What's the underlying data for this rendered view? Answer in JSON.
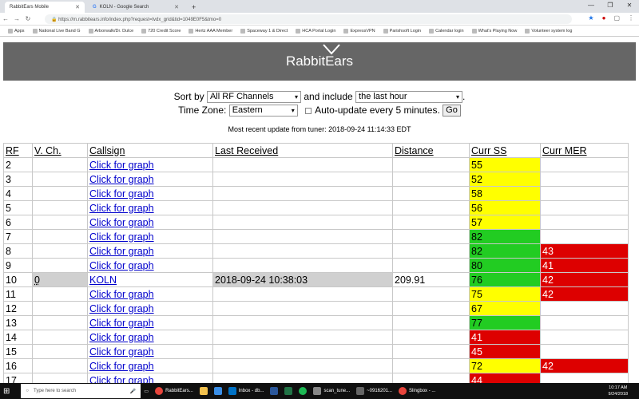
{
  "browser": {
    "tabs": [
      {
        "label": "RabbitEars Mobile",
        "active": true
      },
      {
        "label": "KOLN - Google Search",
        "active": false
      }
    ],
    "new_tab": "+",
    "url": "https://m.rabbitears.info/index.php?request=tvdx_grid&tid=1049E0F5&tmo=0",
    "bookmarks": [
      "Apps",
      "National Live Band G",
      "Arborwalk/Dr. Dulce",
      "720 Credit Score",
      "Hertz AAA Member",
      "Spaceway 1 & Direct",
      "HCA Portal Login",
      "ExpressVPN",
      "Parishsoft Login",
      "Calendar login",
      "What's Playing Now",
      "Volunteer system log"
    ]
  },
  "page": {
    "logo": "RabbitEars",
    "sort_label": "Sort by",
    "sort_value": "All RF Channels",
    "include_label": "and include",
    "include_value": "the last hour",
    "timezone_label": "Time Zone:",
    "timezone_value": "Eastern",
    "auto_label": "Auto-update every 5 minutes.",
    "go_label": "Go",
    "update_text": "Most recent update from tuner: 2018-09-24 11:14:33 EDT"
  },
  "table": {
    "headers": [
      "RF",
      "V. Ch.",
      "Callsign",
      "Last Received",
      "Distance",
      "Curr SS",
      "Curr MER"
    ],
    "rows": [
      {
        "rf": "2",
        "vch": "",
        "callsign": "Click for graph",
        "last": "",
        "dist": "",
        "ss": "55",
        "ss_c": "y",
        "mer": "",
        "mer_c": ""
      },
      {
        "rf": "3",
        "vch": "",
        "callsign": "Click for graph",
        "last": "",
        "dist": "",
        "ss": "52",
        "ss_c": "y",
        "mer": "",
        "mer_c": ""
      },
      {
        "rf": "4",
        "vch": "",
        "callsign": "Click for graph",
        "last": "",
        "dist": "",
        "ss": "58",
        "ss_c": "y",
        "mer": "",
        "mer_c": ""
      },
      {
        "rf": "5",
        "vch": "",
        "callsign": "Click for graph",
        "last": "",
        "dist": "",
        "ss": "56",
        "ss_c": "y",
        "mer": "",
        "mer_c": ""
      },
      {
        "rf": "6",
        "vch": "",
        "callsign": "Click for graph",
        "last": "",
        "dist": "",
        "ss": "57",
        "ss_c": "y",
        "mer": "",
        "mer_c": ""
      },
      {
        "rf": "7",
        "vch": "",
        "callsign": "Click for graph",
        "last": "",
        "dist": "",
        "ss": "82",
        "ss_c": "g",
        "mer": "",
        "mer_c": ""
      },
      {
        "rf": "8",
        "vch": "",
        "callsign": "Click for graph",
        "last": "",
        "dist": "",
        "ss": "82",
        "ss_c": "g",
        "mer": "43",
        "mer_c": "r"
      },
      {
        "rf": "9",
        "vch": "",
        "callsign": "Click for graph",
        "last": "",
        "dist": "",
        "ss": "80",
        "ss_c": "g",
        "mer": "41",
        "mer_c": "r"
      },
      {
        "rf": "10",
        "vch": "0",
        "callsign": "KOLN",
        "last": "2018-09-24 10:38:03",
        "dist": "209.91",
        "ss": "76",
        "ss_c": "g",
        "mer": "42",
        "mer_c": "r",
        "grey": true
      },
      {
        "rf": "11",
        "vch": "",
        "callsign": "Click for graph",
        "last": "",
        "dist": "",
        "ss": "75",
        "ss_c": "y",
        "mer": "42",
        "mer_c": "r"
      },
      {
        "rf": "12",
        "vch": "",
        "callsign": "Click for graph",
        "last": "",
        "dist": "",
        "ss": "67",
        "ss_c": "y",
        "mer": "",
        "mer_c": ""
      },
      {
        "rf": "13",
        "vch": "",
        "callsign": "Click for graph",
        "last": "",
        "dist": "",
        "ss": "77",
        "ss_c": "g",
        "mer": "",
        "mer_c": ""
      },
      {
        "rf": "14",
        "vch": "",
        "callsign": "Click for graph",
        "last": "",
        "dist": "",
        "ss": "41",
        "ss_c": "r",
        "mer": "",
        "mer_c": ""
      },
      {
        "rf": "15",
        "vch": "",
        "callsign": "Click for graph",
        "last": "",
        "dist": "",
        "ss": "45",
        "ss_c": "r",
        "mer": "",
        "mer_c": ""
      },
      {
        "rf": "16",
        "vch": "",
        "callsign": "Click for graph",
        "last": "",
        "dist": "",
        "ss": "72",
        "ss_c": "y",
        "mer": "42",
        "mer_c": "r"
      },
      {
        "rf": "17",
        "vch": "",
        "callsign": "Click for graph",
        "last": "",
        "dist": "",
        "ss": "44",
        "ss_c": "r",
        "mer": "",
        "mer_c": ""
      }
    ]
  },
  "taskbar": {
    "search_placeholder": "Type here to search",
    "items": [
      "RabbitEars...",
      "Inbox - db...",
      "scan_tune...",
      "~0916201...",
      "Slingbox - ..."
    ],
    "time": "10:17 AM",
    "date": "9/24/2018"
  },
  "colors": {
    "yellow": "#ffff00",
    "green": "#22cc22",
    "red": "#dd0000",
    "header": "#666666"
  }
}
